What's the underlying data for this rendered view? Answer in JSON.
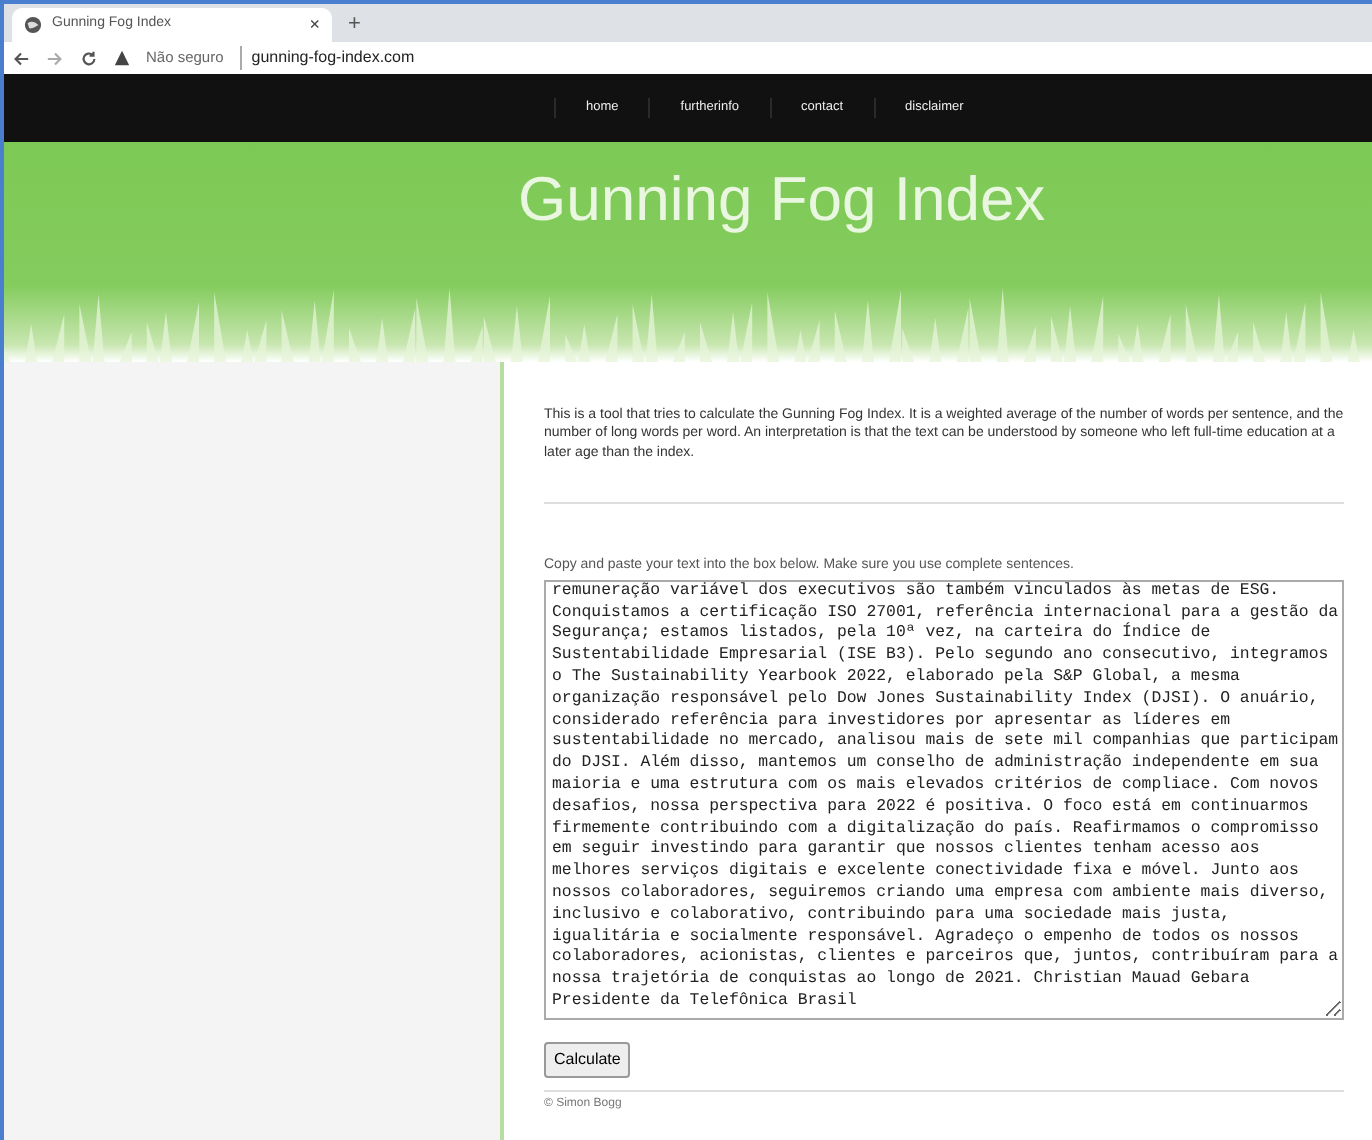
{
  "browser": {
    "tab_title": "Gunning Fog Index",
    "tab_close": "×",
    "new_tab": "+",
    "security": "Não seguro",
    "url": "gunning-fog-index.com"
  },
  "nav": [
    {
      "label": "home"
    },
    {
      "label": "furtherinfo"
    },
    {
      "label": "contact"
    },
    {
      "label": "disclaimer"
    }
  ],
  "header": {
    "title": "Gunning Fog Index"
  },
  "intro": "This is a tool that tries to calculate the Gunning Fog Index. It is a weighted average of the number of words per sentence, and the number of long words per word. An interpretation is that the text can be understood by someone who left full-time education at a later age than the index.",
  "instruction": "Copy and paste your text into the box below. Make sure you use complete sentences.",
  "text_lines": [
    "remuneração variável dos executivos são também vinculados às metas de ESG.",
    "Conquistamos a certificação ISO 27001, referência internacional para a gestão da",
    "Segurança; estamos listados, pela 10ª vez, na carteira do Índice de",
    "Sustentabilidade Empresarial (ISE B3). Pelo segundo ano consecutivo, integramos",
    "o The Sustainability Yearbook 2022, elaborado pela S&P Global, a mesma",
    "organização responsável pelo Dow Jones Sustainability Index (DJSI). O anuário,",
    "considerado referência para investidores por apresentar as líderes em",
    "sustentabilidade no mercado, analisou mais de sete mil companhias que participam",
    "do DJSI. Além disso, mantemos um conselho de administração independente em sua",
    "maioria e uma estrutura com os mais elevados critérios de compliace. Com novos",
    "desafios, nossa perspectiva para 2022 é positiva. O foco está em continuarmos",
    "firmemente contribuindo com a digitalização do país. Reafirmamos o compromisso",
    "em seguir investindo para garantir que nossos clientes tenham acesso aos",
    "melhores serviços digitais e excelente conectividade fixa e móvel. Junto aos",
    "nossos colaboradores, seguiremos criando uma empresa com ambiente mais diverso,",
    "inclusivo e colaborativo, contribuindo para uma sociedade mais justa,",
    "igualitária e socialmente responsável. Agradeço o empenho de todos os nossos",
    "colaboradores, acionistas, clientes e parceiros que, juntos, contribuíram para a",
    "nossa trajetória de conquistas ao longo de 2021. Christian Mauad Gebara",
    "Presidente da Telefônica Brasil"
  ],
  "button": "Calculate",
  "footer": "© Simon Bogg"
}
